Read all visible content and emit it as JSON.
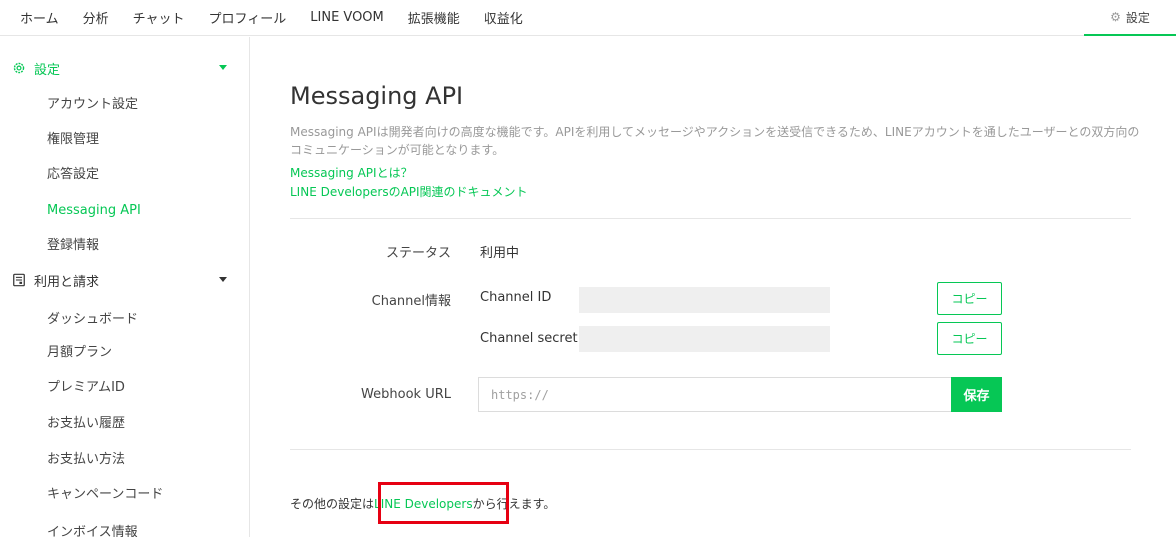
{
  "topnav": {
    "items": [
      {
        "label": "ホーム"
      },
      {
        "label": "分析"
      },
      {
        "label": "チャット"
      },
      {
        "label": "プロフィール"
      },
      {
        "label": "LINE VOOM"
      },
      {
        "label": "拡張機能"
      },
      {
        "label": "収益化"
      }
    ],
    "settings_label": "設定",
    "settings_icon": "gear-icon"
  },
  "sidebar": {
    "settings_section": {
      "label": "設定",
      "icon": "gear-icon",
      "expanded": true
    },
    "settings_items": [
      {
        "label": "アカウント設定"
      },
      {
        "label": "権限管理"
      },
      {
        "label": "応答設定"
      },
      {
        "label": "Messaging API",
        "active": true
      },
      {
        "label": "登録情報"
      }
    ],
    "billing_section": {
      "label": "利用と請求",
      "icon": "document-icon",
      "expanded": true
    },
    "billing_items": [
      {
        "label": "ダッシュボード"
      },
      {
        "label": "月額プラン"
      },
      {
        "label": "プレミアムID"
      },
      {
        "label": "お支払い履歴"
      },
      {
        "label": "お支払い方法"
      },
      {
        "label": "キャンペーンコード"
      },
      {
        "label": "インボイス情報"
      }
    ]
  },
  "main": {
    "title": "Messaging API",
    "description": "Messaging APIは開発者向けの高度な機能です。APIを利用してメッセージやアクションを送受信できるため、LINEアカウントを通したユーザーとの双方向のコミュニケーションが可能となります。",
    "link_what": "Messaging APIとは？",
    "link_docs": "LINE DevelopersのAPI関連のドキュメント",
    "status": {
      "label": "ステータス",
      "value": "利用中"
    },
    "channel": {
      "label": "Channel情報",
      "id_label": "Channel ID",
      "secret_label": "Channel secret",
      "copy_label": "コピー"
    },
    "webhook": {
      "label": "Webhook URL",
      "placeholder": "https://",
      "save_label": "保存"
    },
    "footer": {
      "prefix": "その他の設定は",
      "link": "LINE Developers",
      "suffix": "から行えます。"
    }
  },
  "colors": {
    "accent": "#06c755",
    "highlight": "#e60012"
  }
}
